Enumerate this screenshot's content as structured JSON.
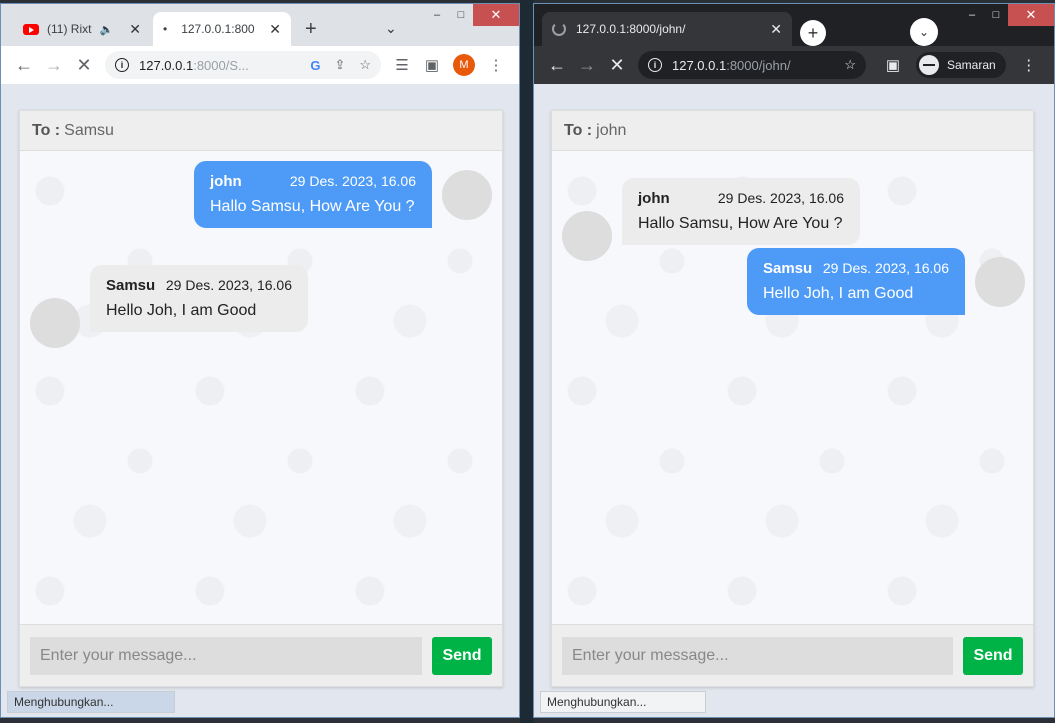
{
  "left": {
    "tabs": [
      {
        "title": "(11) Rixt",
        "audio": "🔈",
        "close": "✕"
      },
      {
        "title": "127.0.0.1:800",
        "loading": "•",
        "close": "✕"
      }
    ],
    "new_tab": "+",
    "tab_menu": "⌄",
    "window_controls": {
      "minimize": "–",
      "maximize": "□",
      "close": "✕"
    },
    "url_host": "127.0.0.1",
    "url_path": ":8000/S...",
    "profile_initial": "M",
    "header_label": "To :",
    "header_value": "Samsu",
    "messages": [
      {
        "name": "john",
        "time": "29 Des. 2023, 16.06",
        "text": "Hallo Samsu, How Are You ?"
      },
      {
        "name": "Samsu",
        "time": "29 Des. 2023, 16.06",
        "text": "Hello Joh, I am Good"
      }
    ],
    "input_placeholder": "Enter your message...",
    "send_label": "Send",
    "status": "Menghubungkan..."
  },
  "right": {
    "tabs": [
      {
        "title": "127.0.0.1:8000/john/",
        "close": "✕"
      }
    ],
    "new_tab": "+",
    "tab_menu": "⌄",
    "window_controls": {
      "minimize": "–",
      "maximize": "□",
      "close": "✕"
    },
    "url_host": "127.0.0.1",
    "url_path": ":8000/john/",
    "incognito_label": "Samaran",
    "header_label": "To :",
    "header_value": "john",
    "messages": [
      {
        "name": "john",
        "time": "29 Des. 2023, 16.06",
        "text": "Hallo Samsu, How Are You ?"
      },
      {
        "name": "Samsu",
        "time": "29 Des. 2023, 16.06",
        "text": "Hello Joh, I am Good"
      }
    ],
    "input_placeholder": "Enter your message...",
    "send_label": "Send",
    "status": "Menghubungkan..."
  },
  "icons": {
    "back": "←",
    "forward": "→",
    "stop": "✕",
    "info": "i",
    "google": "G",
    "share": "⇪",
    "star": "☆",
    "reading_list": "☰",
    "side_panel": "▣",
    "menu": "⋮"
  },
  "colors": {
    "sent_bubble": "#4d9bf7",
    "received_bubble": "#ececec",
    "send_button": "#00b347"
  }
}
